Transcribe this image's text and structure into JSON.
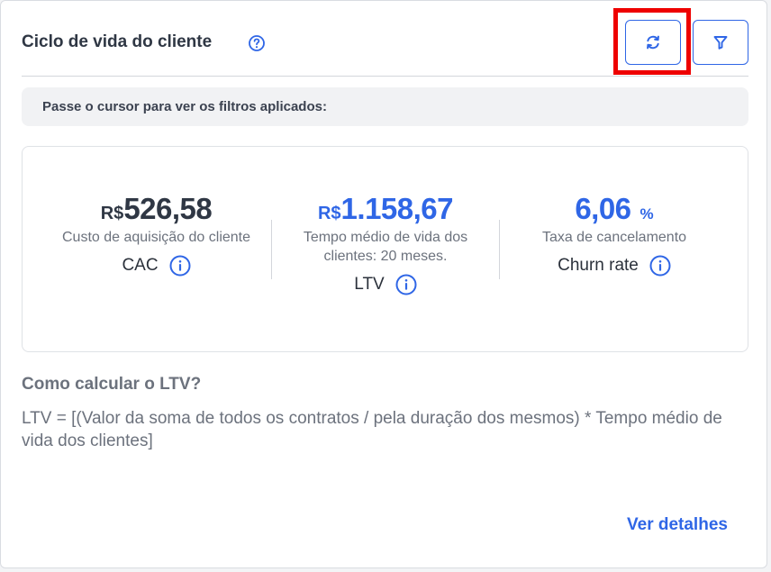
{
  "card": {
    "title": "Ciclo de vida do cliente",
    "filters_hint": "Passe o cursor para ver os filtros aplicados:"
  },
  "metrics": [
    {
      "currency": "R$",
      "value": "526,58",
      "description": "Custo de aquisição do cliente",
      "label": "CAC",
      "value_color": "#2f3744"
    },
    {
      "currency": "R$",
      "value": "1.158,67",
      "description": "Tempo médio de vida dos clientes: 20 meses.",
      "label": "LTV",
      "value_color": "#2f66e6"
    },
    {
      "value": "6,06",
      "unit": "%",
      "description": "Taxa de cancelamento",
      "label": "Churn rate",
      "value_color": "#2f66e6"
    }
  ],
  "explanation": {
    "title": "Como calcular o LTV?",
    "text": "LTV = [(Valor da soma de todos os contratos / pela duração dos mesmos) * Tempo médio de vida dos clientes]"
  },
  "footer": {
    "details_link": "Ver detalhes"
  },
  "icons": {
    "help": "question-circle-icon",
    "refresh": "refresh-icon",
    "filter": "filter-icon",
    "info": "info-circle-icon"
  },
  "colors": {
    "accent": "#2f66e6",
    "highlight": "#ee0000"
  }
}
